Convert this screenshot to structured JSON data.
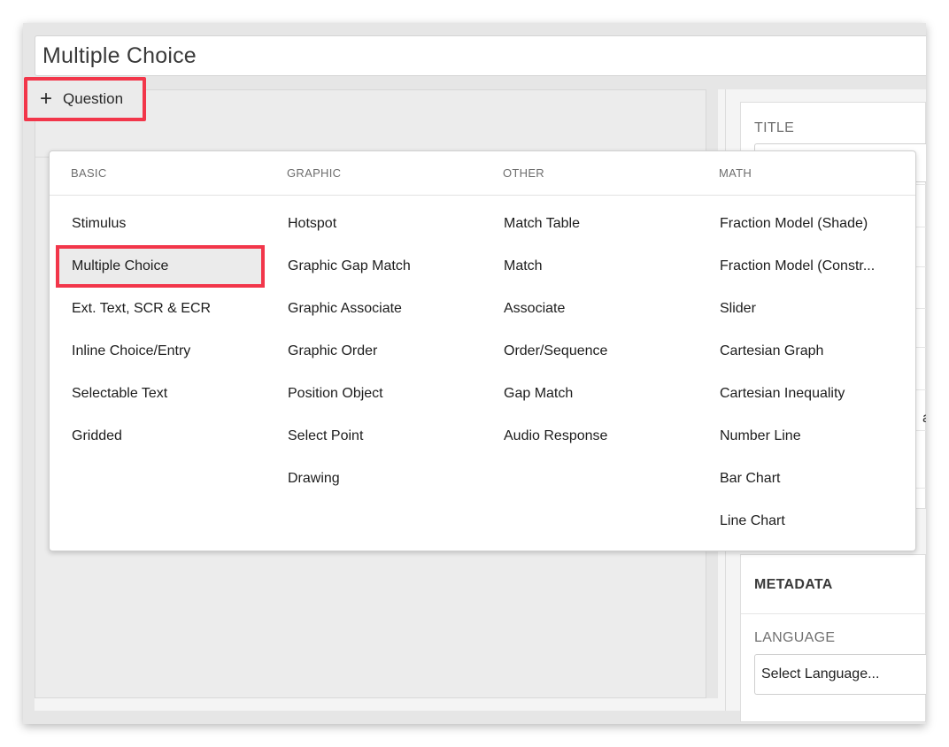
{
  "document": {
    "title": "Multiple Choice"
  },
  "toolbar": {
    "add_question_label": "Question",
    "add_icon": "plus-icon"
  },
  "settings": {
    "title_label": "TITLE",
    "partial_text": "al",
    "metadata_title": "METADATA",
    "language_label": "LANGUAGE",
    "language_value": "Select Language..."
  },
  "dropdown": {
    "columns": [
      {
        "title": "BASIC",
        "items": [
          "Stimulus",
          "Multiple Choice",
          "Ext. Text, SCR & ECR",
          "Inline Choice/Entry",
          "Selectable Text",
          "Gridded"
        ]
      },
      {
        "title": "GRAPHIC",
        "items": [
          "Hotspot",
          "Graphic Gap Match",
          "Graphic Associate",
          "Graphic Order",
          "Position Object",
          "Select Point",
          "Drawing"
        ]
      },
      {
        "title": "OTHER",
        "items": [
          "Match Table",
          "Match",
          "Associate",
          "Order/Sequence",
          "Gap Match",
          "Audio Response"
        ]
      },
      {
        "title": "MATH",
        "items": [
          "Fraction Model (Shade)",
          "Fraction Model (Constr...",
          "Slider",
          "Cartesian Graph",
          "Cartesian Inequality",
          "Number Line",
          "Bar Chart",
          "Line Chart"
        ]
      }
    ],
    "selected": "Multiple Choice"
  },
  "colors": {
    "highlight": "#f2364a",
    "selected_bg": "#ebebeb"
  }
}
